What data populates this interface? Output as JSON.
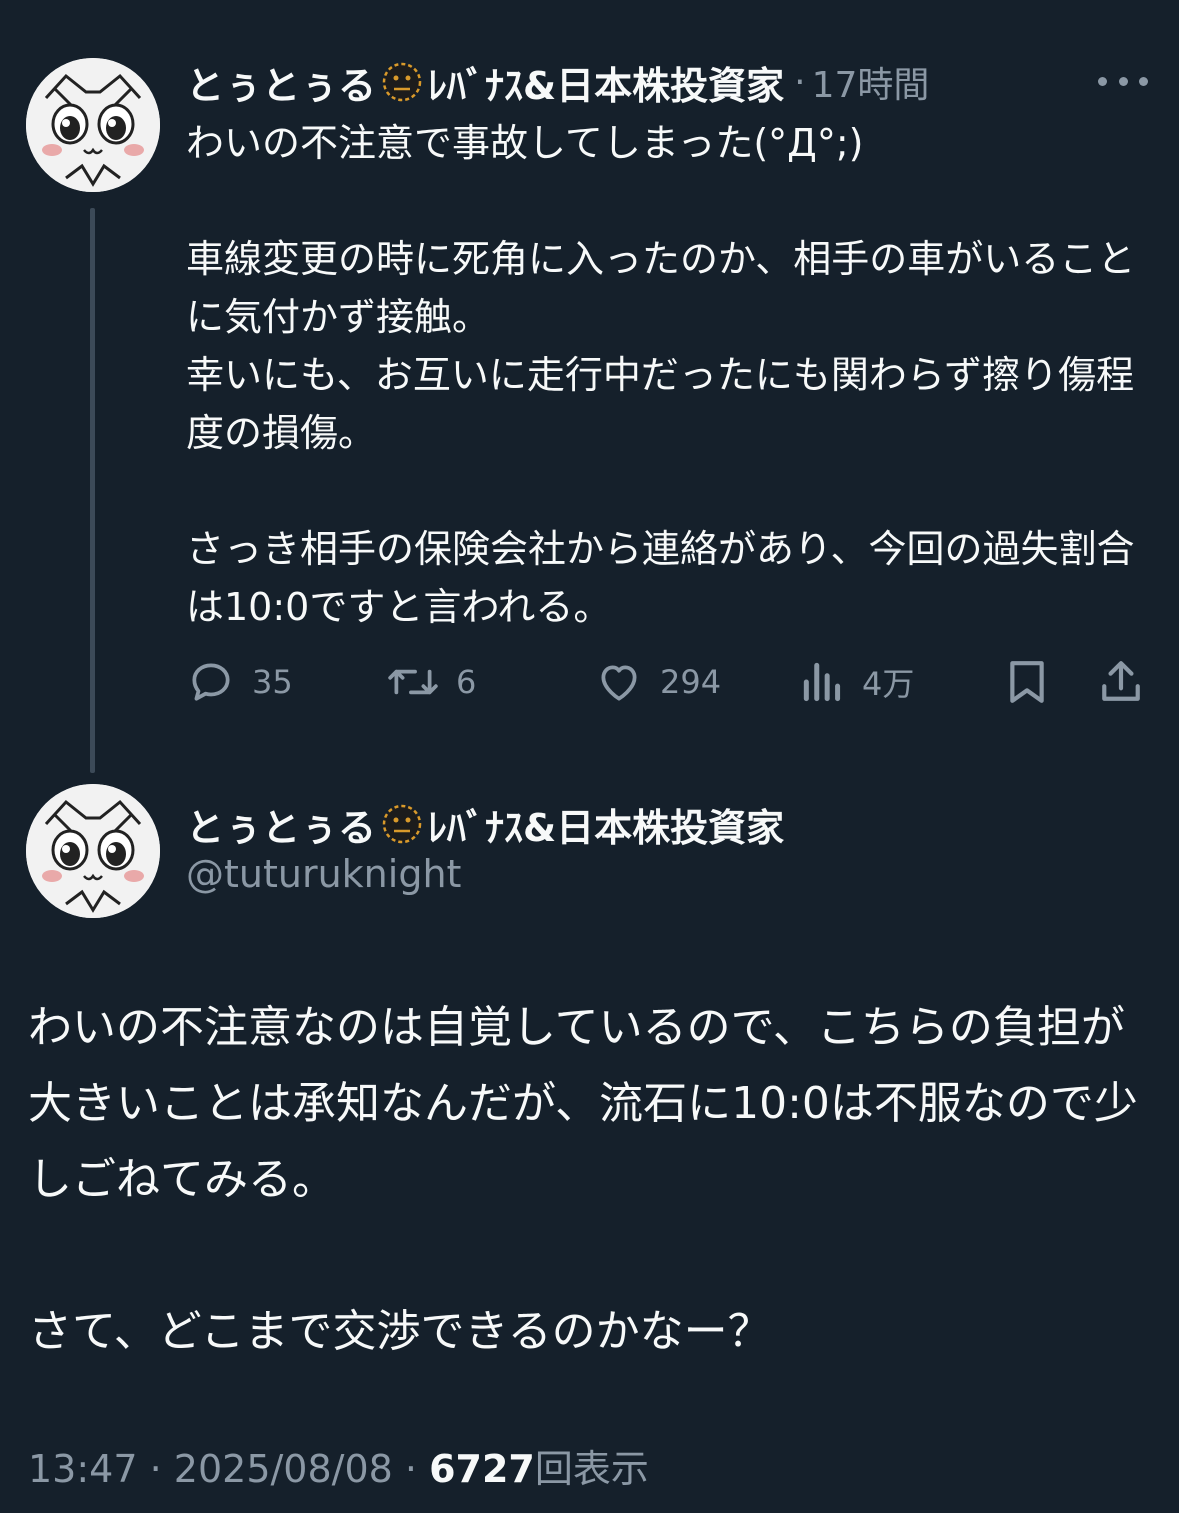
{
  "reply_tweet": {
    "display_name_prefix": "とぅとぅる",
    "emoji_icon": "neutral-face-emoji-icon",
    "display_name_suffix": "ﾚﾊﾞﾅｽ&日本株投資家",
    "separator": "·",
    "time_ago": "17時間",
    "text": "わいの不注意で事故してしまった(°Д°;)\n\n車線変更の時に死角に入ったのか、相手の車がいることに気付かず接触。\n幸いにも、お互いに走行中だったにも関わらず擦り傷程度の損傷。\n\nさっき相手の保険会社から連絡があり、今回の過失割合は10:0ですと言われる。",
    "actions": {
      "reply_count": "35",
      "retweet_count": "6",
      "like_count": "294",
      "views_count": "4万"
    }
  },
  "main_tweet": {
    "display_name_prefix": "とぅとぅる",
    "display_name_suffix": "ﾚﾊﾞﾅｽ&日本株投資家",
    "handle": "@tuturuknight",
    "text": "わいの不注意なのは自覚しているので、こちらの負担が大きいことは承知なんだが、流石に10:0は不服なので少しごねてみる。\n\nさて、どこまで交渉できるのかなー？",
    "time": "13:47",
    "date": "2025/08/08",
    "sep": "·",
    "views": "6727",
    "views_label": "回表示"
  },
  "colors": {
    "background": "#15202b",
    "text_primary": "#f7f9f9",
    "text_secondary": "#8b98a5",
    "thread_line": "#3c4a58",
    "emoji_face": "#1c1c1c",
    "emoji_outline": "#d99a2b"
  }
}
